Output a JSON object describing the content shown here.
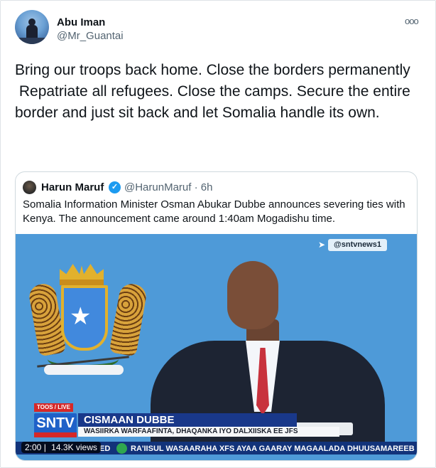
{
  "author": {
    "name": "Abu Iman",
    "handle": "@Mr_Guantai"
  },
  "tweet": {
    "text": "Bring our troops back home. Close the borders permanently\n Repatriate all refugees. Close the camps. Secure the entire border and just sit back and let Somalia handle its own."
  },
  "quoted_tweet": {
    "name": "Harun Maruf",
    "handle": "@HarunMaruf",
    "time": "6h",
    "text": "Somalia Information Minister Osman Abukar Dubbe announces severing ties with Kenya. The announcement came around 1:40am Mogadishu time.",
    "video": {
      "watermark": "@sntvnews1",
      "live_label": "TOOS / LIVE",
      "channel_logo": "SNTV",
      "lower_third_name": "CISMAAN DUBBE",
      "lower_third_title": "WASIIRKA WARFAAFINTA, DHAQANKA IYO DALXIISKA EE JFS",
      "ticker_prefix": "ED",
      "ticker": "RA'IISUL WASAARAHA XFS AYAA GAARAY MAGAALADA DHUUSAMAREEB",
      "time": "2:00",
      "views": "14.3K views"
    }
  },
  "colors": {
    "verified": "#1d9bf0",
    "video_bg": "#4e9ad8",
    "ticker_bg": "#12337a"
  },
  "icons": {
    "more": "more-horizontal-icon",
    "verified": "verified-badge-icon"
  }
}
